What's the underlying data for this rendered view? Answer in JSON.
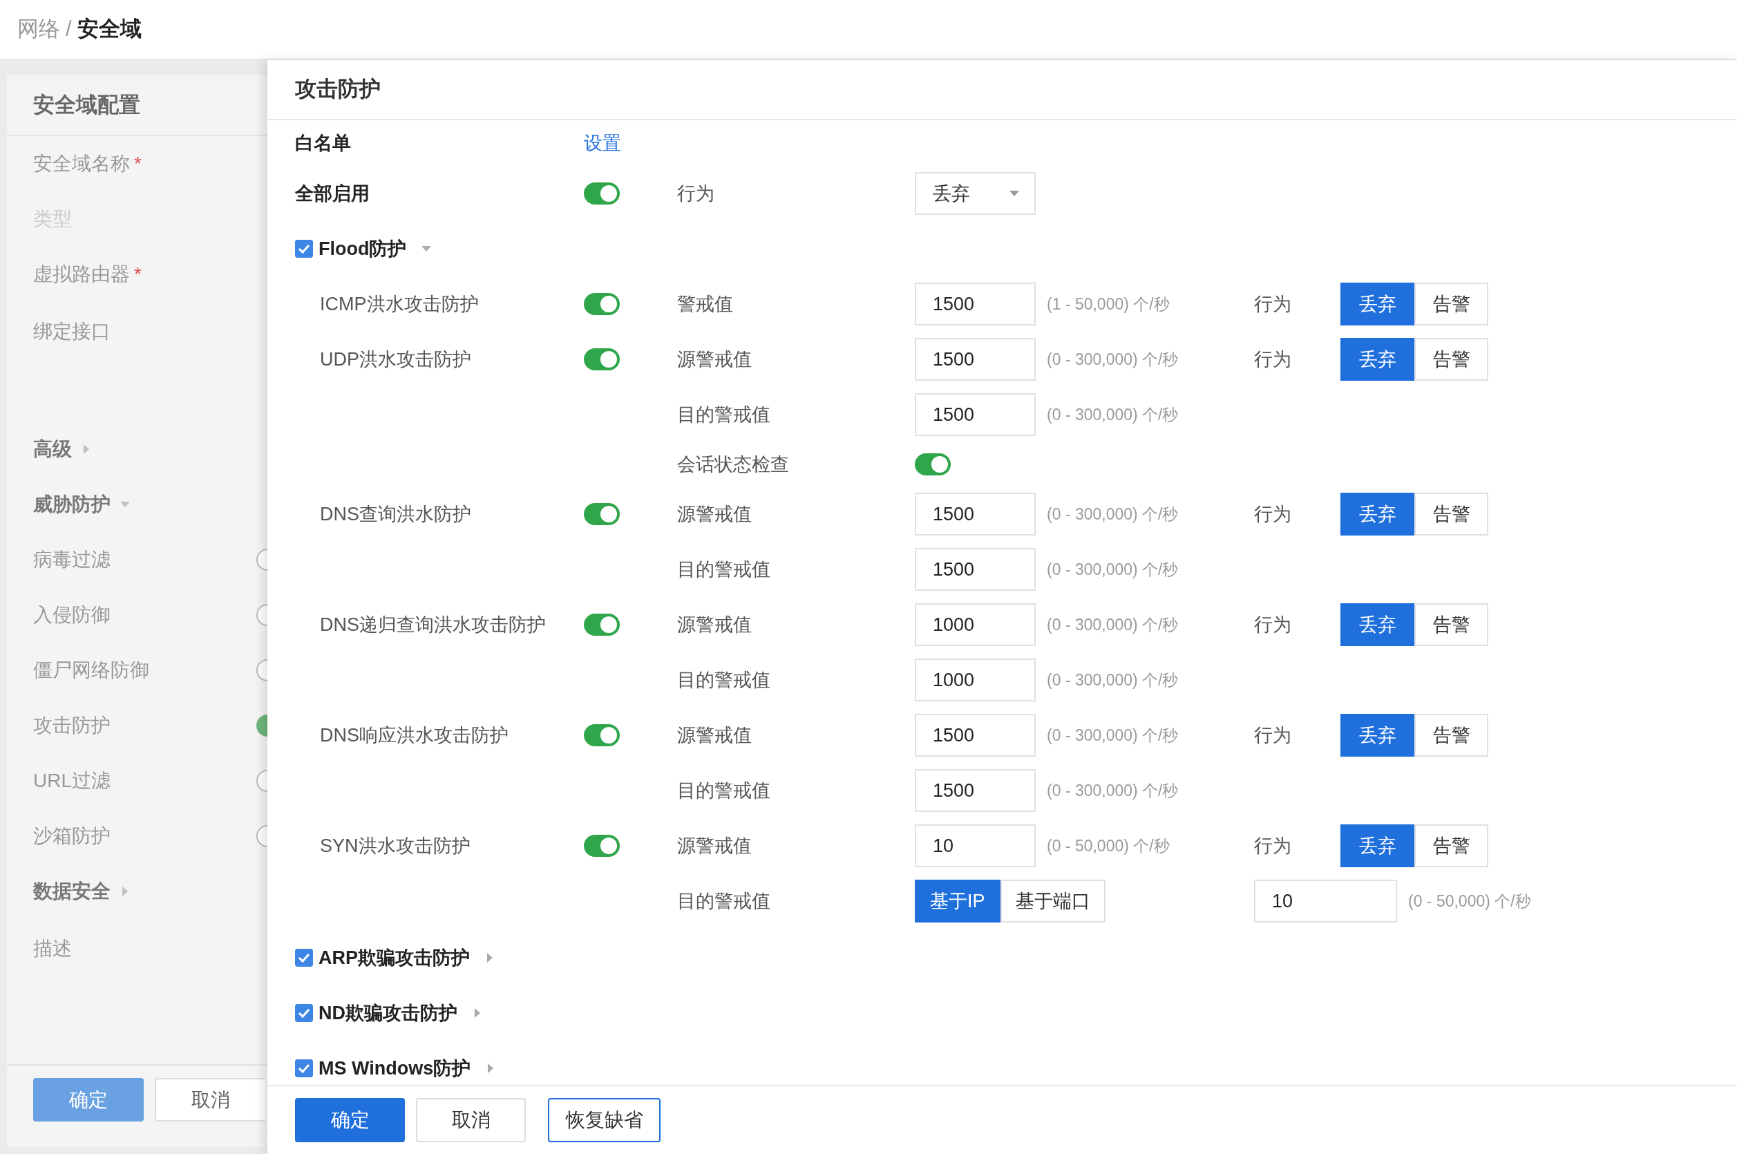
{
  "breadcrumb": {
    "separator": "/",
    "items": [
      {
        "label": "网络",
        "current": false
      },
      {
        "label": "安全域",
        "current": true
      }
    ]
  },
  "side_panel": {
    "title": "安全域配置",
    "required_mark": "*",
    "items": [
      {
        "kind": "field",
        "label": "安全域名称",
        "required": true,
        "disabled": false
      },
      {
        "kind": "field",
        "label": "类型",
        "required": false,
        "disabled": true
      },
      {
        "kind": "field",
        "label": "虚拟路由器",
        "required": true,
        "disabled": false
      },
      {
        "kind": "tallfield",
        "label": "绑定接口",
        "required": false,
        "disabled": false
      },
      {
        "kind": "section",
        "label": "高级",
        "expanded": false
      },
      {
        "kind": "section",
        "label": "威胁防护",
        "expanded": true
      },
      {
        "kind": "toggle",
        "label": "病毒过滤",
        "on": false
      },
      {
        "kind": "toggle",
        "label": "入侵防御",
        "on": false
      },
      {
        "kind": "toggle",
        "label": "僵尸网络防御",
        "on": false
      },
      {
        "kind": "toggle",
        "label": "攻击防护",
        "on": true
      },
      {
        "kind": "toggle",
        "label": "URL过滤",
        "on": false
      },
      {
        "kind": "toggle",
        "label": "沙箱防护",
        "on": false
      },
      {
        "kind": "section",
        "label": "数据安全",
        "expanded": false
      },
      {
        "kind": "field",
        "label": "描述",
        "required": false,
        "disabled": false
      }
    ],
    "buttons": [
      {
        "label": "确定",
        "kind": "primary"
      },
      {
        "label": "取消",
        "kind": "default"
      }
    ]
  },
  "drawer": {
    "title": "攻击防护",
    "whitelist": {
      "label": "白名单",
      "link": "设置"
    },
    "enable_all": {
      "label": "全部启用",
      "on": true,
      "action_label": "行为",
      "action": "丢弃"
    },
    "groups": [
      {
        "label": "Flood防护",
        "checked": true,
        "expanded": true,
        "items": [
          {
            "name": "ICMP洪水攻击防护",
            "on": true,
            "action_label": "行为",
            "actions": [
              {
                "label": "丢弃",
                "selected": true
              },
              {
                "label": "告警",
                "selected": false
              }
            ],
            "params": [
              {
                "kind": "threshold",
                "label": "警戒值",
                "value": "1500",
                "range": "(1 - 50,000) 个/秒"
              }
            ]
          },
          {
            "name": "UDP洪水攻击防护",
            "on": true,
            "action_label": "行为",
            "actions": [
              {
                "label": "丢弃",
                "selected": true
              },
              {
                "label": "告警",
                "selected": false
              }
            ],
            "params": [
              {
                "kind": "threshold",
                "label": "源警戒值",
                "value": "1500",
                "range": "(0 - 300,000) 个/秒"
              },
              {
                "kind": "threshold",
                "label": "目的警戒值",
                "value": "1500",
                "range": "(0 - 300,000) 个/秒"
              },
              {
                "kind": "switch",
                "label": "会话状态检查",
                "on": true
              }
            ]
          },
          {
            "name": "DNS查询洪水防护",
            "on": true,
            "action_label": "行为",
            "actions": [
              {
                "label": "丢弃",
                "selected": true
              },
              {
                "label": "告警",
                "selected": false
              }
            ],
            "params": [
              {
                "kind": "threshold",
                "label": "源警戒值",
                "value": "1500",
                "range": "(0 - 300,000) 个/秒"
              },
              {
                "kind": "threshold",
                "label": "目的警戒值",
                "value": "1500",
                "range": "(0 - 300,000) 个/秒"
              }
            ]
          },
          {
            "name": "DNS递归查询洪水攻击防护",
            "on": true,
            "action_label": "行为",
            "actions": [
              {
                "label": "丢弃",
                "selected": true
              },
              {
                "label": "告警",
                "selected": false
              }
            ],
            "params": [
              {
                "kind": "threshold",
                "label": "源警戒值",
                "value": "1000",
                "range": "(0 - 300,000) 个/秒"
              },
              {
                "kind": "threshold",
                "label": "目的警戒值",
                "value": "1000",
                "range": "(0 - 300,000) 个/秒"
              }
            ]
          },
          {
            "name": "DNS响应洪水攻击防护",
            "on": true,
            "action_label": "行为",
            "actions": [
              {
                "label": "丢弃",
                "selected": true
              },
              {
                "label": "告警",
                "selected": false
              }
            ],
            "params": [
              {
                "kind": "threshold",
                "label": "源警戒值",
                "value": "1500",
                "range": "(0 - 300,000) 个/秒"
              },
              {
                "kind": "threshold",
                "label": "目的警戒值",
                "value": "1500",
                "range": "(0 - 300,000) 个/秒"
              }
            ]
          },
          {
            "name": "SYN洪水攻击防护",
            "on": true,
            "action_label": "行为",
            "actions": [
              {
                "label": "丢弃",
                "selected": true
              },
              {
                "label": "告警",
                "selected": false
              }
            ],
            "params": [
              {
                "kind": "threshold",
                "label": "源警戒值",
                "value": "10",
                "range": "(0 - 50,000) 个/秒"
              },
              {
                "kind": "mode",
                "label": "目的警戒值",
                "modes": [
                  {
                    "label": "基于IP",
                    "selected": true
                  },
                  {
                    "label": "基于端口",
                    "selected": false
                  }
                ],
                "value": "10",
                "range": "(0 - 50,000) 个/秒"
              }
            ]
          }
        ]
      },
      {
        "label": "ARP欺骗攻击防护",
        "checked": true,
        "expanded": false
      },
      {
        "label": "ND欺骗攻击防护",
        "checked": true,
        "expanded": false
      },
      {
        "label": "MS Windows防护",
        "checked": true,
        "expanded": false
      }
    ],
    "buttons": [
      {
        "label": "确定",
        "kind": "primary"
      },
      {
        "label": "取消",
        "kind": "default"
      },
      {
        "label": "恢复缺省",
        "kind": "outline"
      }
    ]
  }
}
